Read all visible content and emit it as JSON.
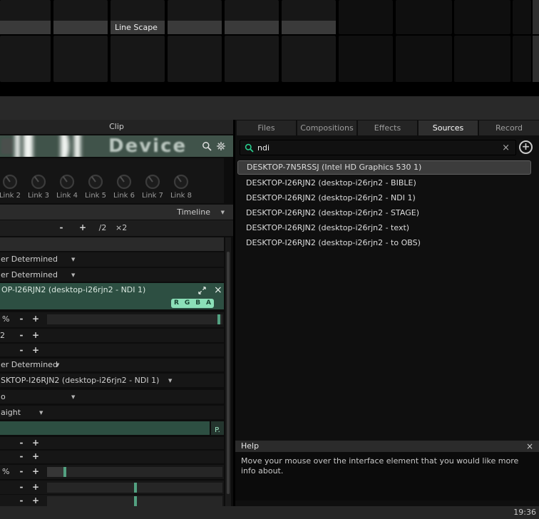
{
  "glyphs": {
    "caret_down": "▼",
    "close": "×",
    "minus": "-",
    "plus": "+"
  },
  "clip_grid": {
    "clip_label": "Line Scape"
  },
  "clip_panel": {
    "title": "Clip",
    "banner_title": "Device",
    "links": [
      "Link 2",
      "Link 3",
      "Link 4",
      "Link 5",
      "Link 6",
      "Link 7",
      "Link 8"
    ],
    "timeline_mode": "Timeline",
    "transport": {
      "minus": "-",
      "plus": "+",
      "half_speed": "/2",
      "double_speed": "×2"
    },
    "dropdown_player_1": "er Determined",
    "dropdown_player_2": "er Determined",
    "source_header": "OP-I26RJN2 (desktop-i26rjn2 - NDI 1)",
    "rgba": [
      "R",
      "G",
      "B",
      "A"
    ],
    "percent_label": "%",
    "label_2": "2",
    "dropdown_player_3": "er Determined",
    "dropdown_source": "SKTOP-I26RJN2 (desktop-i26rjn2 - NDI 1)",
    "dropdown_o": "o",
    "dropdown_aight": "aight",
    "p_button": "P."
  },
  "sources_panel": {
    "tabs": [
      "Files",
      "Compositions",
      "Effects",
      "Sources",
      "Record"
    ],
    "active_tab": "Sources",
    "search_value": "ndi",
    "add_button": "+",
    "items": [
      "DESKTOP-7N5RSSJ (Intel HD Graphics 530 1)",
      "DESKTOP-I26RJN2 (desktop-i26rjn2 - BIBLE)",
      "DESKTOP-I26RJN2 (desktop-i26rjn2 - NDI 1)",
      "DESKTOP-I26RJN2 (desktop-i26rjn2 - STAGE)",
      "DESKTOP-I26RJN2 (desktop-i26rjn2 - text)",
      "DESKTOP-I26RJN2 (desktop-i26rjn2 - to OBS)"
    ]
  },
  "help_panel": {
    "title": "Help",
    "body": "Move your mouse over the interface element that you would like more info about."
  },
  "status_bar": {
    "time": "19:36"
  }
}
